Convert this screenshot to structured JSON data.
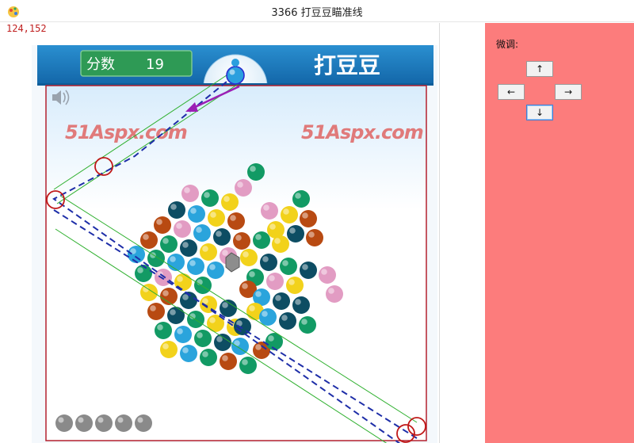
{
  "window": {
    "title": "3366 打豆豆瞄准线"
  },
  "overlay": {
    "coords": "124,152"
  },
  "game": {
    "score_label": "分数",
    "score_value": "19",
    "logo_text": "打豆豆",
    "watermark_left": "51Aspx.com",
    "watermark_right": "51Aspx.com",
    "remaining_balls": 5
  },
  "controls": {
    "label": "微调:",
    "up": "↑",
    "left": "←",
    "right": "→",
    "down": "↓"
  },
  "colors": {
    "panel_bg": "#fc7c7c",
    "header_blue": "#1679bd",
    "score_green": "#2e9a55",
    "aim_line": "#1e2ea8",
    "guide_green": "#2fb02f",
    "marker_red": "#c01818"
  }
}
